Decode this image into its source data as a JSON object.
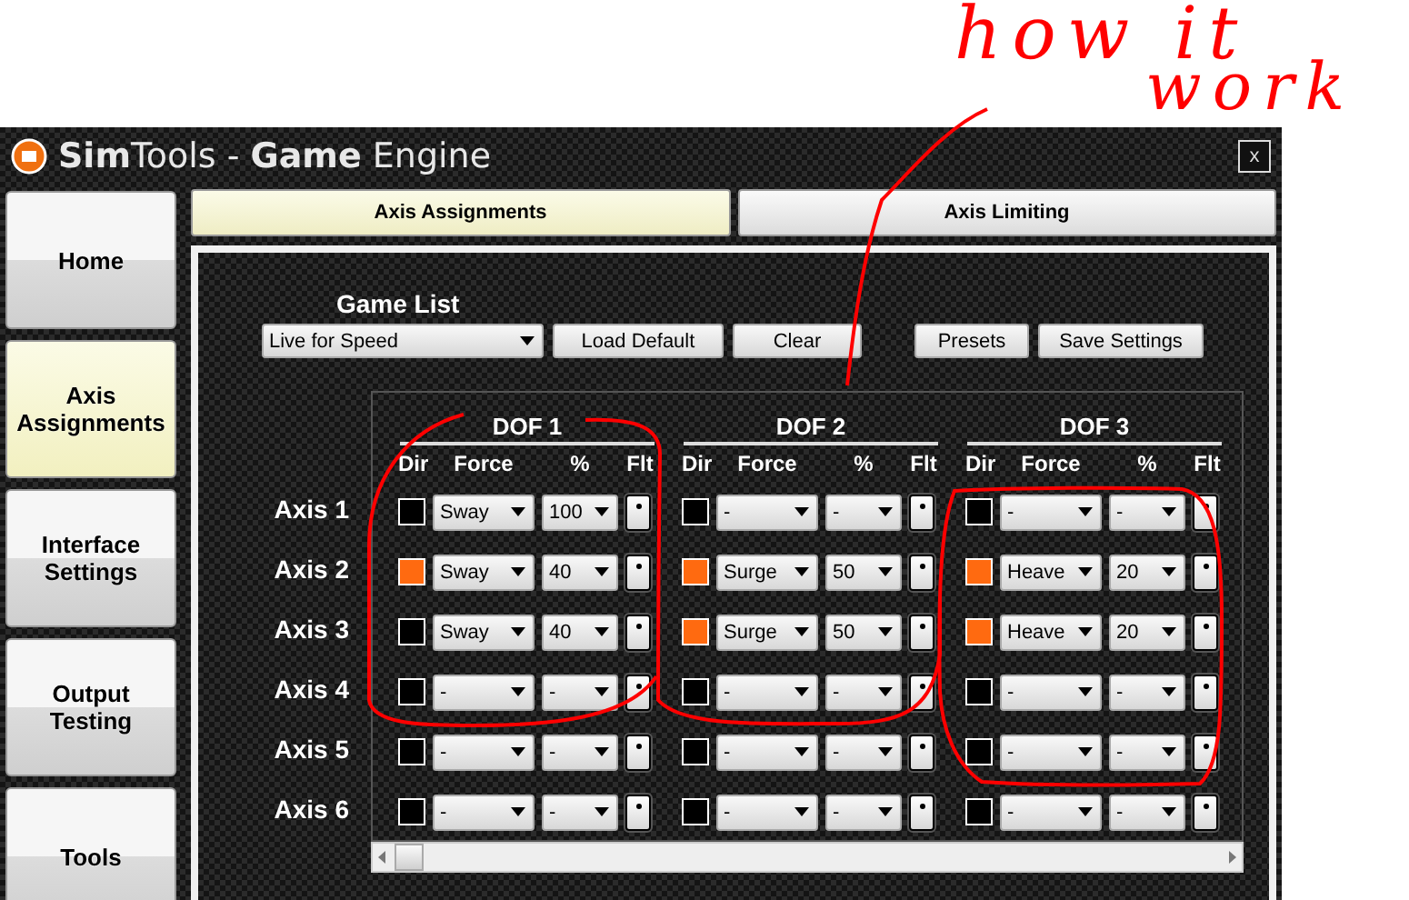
{
  "window": {
    "title": "**Sim**Tools - **Game** Engine",
    "close": "x"
  },
  "sidebar": [
    {
      "label": "Home",
      "selected": false
    },
    {
      "label": "Axis Assignments",
      "selected": true
    },
    {
      "label": "Interface Settings",
      "selected": false
    },
    {
      "label": "Output Testing",
      "selected": false
    },
    {
      "label": "Tools",
      "selected": false
    }
  ],
  "tabs": [
    {
      "label": "Axis Assignments",
      "selected": true
    },
    {
      "label": "Axis Limiting",
      "selected": false
    }
  ],
  "game_list": {
    "label": "Game List",
    "value": "Live for Speed"
  },
  "buttons": [
    "Load Default",
    "Clear",
    "Presets",
    "Save Settings"
  ],
  "dofs": [
    {
      "title": "DOF 1",
      "headers": [
        "Dir",
        "Force",
        "%",
        "Flt"
      ]
    },
    {
      "title": "DOF 2",
      "headers": [
        "Dir",
        "Force",
        "%",
        "Flt"
      ]
    },
    {
      "title": "DOF 3",
      "headers": [
        "Dir",
        "Force",
        "%",
        "Flt"
      ]
    }
  ],
  "axes": [
    {
      "label": "Axis 1",
      "cells": [
        {
          "dir": false,
          "force": "Sway",
          "percent": "100"
        },
        {
          "dir": false,
          "force": "-",
          "percent": "-"
        },
        {
          "dir": false,
          "force": "-",
          "percent": "-"
        }
      ]
    },
    {
      "label": "Axis 2",
      "cells": [
        {
          "dir": true,
          "force": "Sway",
          "percent": "40"
        },
        {
          "dir": true,
          "force": "Surge",
          "percent": "50"
        },
        {
          "dir": true,
          "force": "Heave",
          "percent": "20"
        }
      ]
    },
    {
      "label": "Axis 3",
      "cells": [
        {
          "dir": false,
          "force": "Sway",
          "percent": "40"
        },
        {
          "dir": true,
          "force": "Surge",
          "percent": "50"
        },
        {
          "dir": true,
          "force": "Heave",
          "percent": "20"
        }
      ]
    },
    {
      "label": "Axis 4",
      "cells": [
        {
          "dir": false,
          "force": "-",
          "percent": "-"
        },
        {
          "dir": false,
          "force": "-",
          "percent": "-"
        },
        {
          "dir": false,
          "force": "-",
          "percent": "-"
        }
      ]
    },
    {
      "label": "Axis 5",
      "cells": [
        {
          "dir": false,
          "force": "-",
          "percent": "-"
        },
        {
          "dir": false,
          "force": "-",
          "percent": "-"
        },
        {
          "dir": false,
          "force": "-",
          "percent": "-"
        }
      ]
    },
    {
      "label": "Axis 6",
      "cells": [
        {
          "dir": false,
          "force": "-",
          "percent": "-"
        },
        {
          "dir": false,
          "force": "-",
          "percent": "-"
        },
        {
          "dir": false,
          "force": "-",
          "percent": "-"
        }
      ]
    }
  ],
  "annotation": [
    "how it",
    "work"
  ]
}
